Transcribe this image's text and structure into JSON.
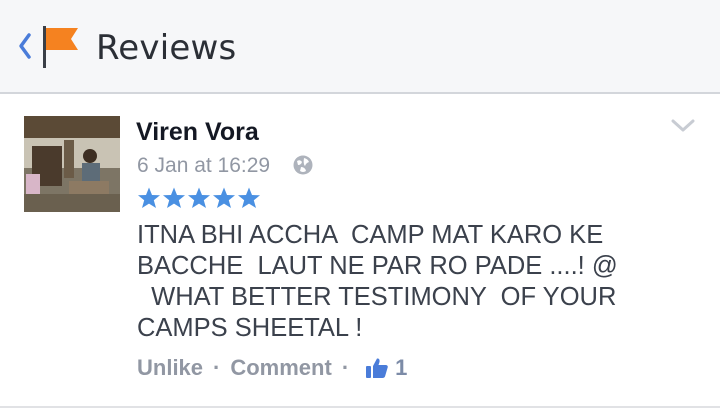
{
  "header": {
    "title": "Reviews",
    "back_icon": "chevron-left-icon",
    "page_icon": "orange-flag-icon",
    "accent_color": "#f58220"
  },
  "review": {
    "author": "Viren Vora",
    "timestamp": "6 Jan at 16:29",
    "privacy_icon": "globe-icon",
    "rating": 5,
    "rating_max": 5,
    "star_color": "#4a90e2",
    "text": "ITNA BHI ACCHA  CAMP MAT KARO KE\nBACCHE  LAUT NE PAR RO PADE ....! @\n  WHAT BETTER TESTIMONY  OF YOUR\nCAMPS SHEETAL !",
    "options_icon": "chevron-down-icon",
    "actions": {
      "unlike_label": "Unlike",
      "separator": "·",
      "comment_label": "Comment",
      "like_count": "1",
      "like_icon": "thumbs-up-icon"
    }
  }
}
